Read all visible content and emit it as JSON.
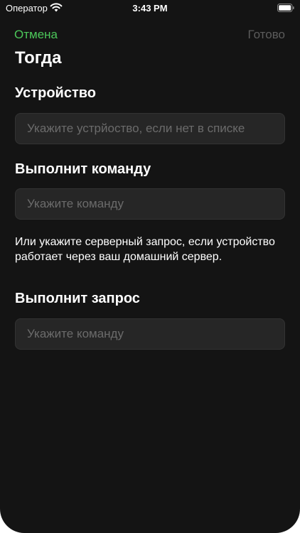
{
  "status_bar": {
    "carrier": "Оператор",
    "time": "3:43 PM",
    "wifi_icon": "wifi-icon",
    "battery_icon": "battery-icon"
  },
  "nav": {
    "cancel_label": "Отмена",
    "done_label": "Готово"
  },
  "page": {
    "title": "Тогда"
  },
  "device_section": {
    "title": "Устройство",
    "placeholder": "Укажите устрйоство, если нет в списке",
    "value": ""
  },
  "command_section": {
    "title": "Выполнит команду",
    "placeholder": "Укажите команду",
    "value": ""
  },
  "hint": {
    "text": "Или укажите серверный запрос, если устройство работает через ваш домашний сервер."
  },
  "request_section": {
    "title": "Выполнит запрос",
    "placeholder": "Укажите команду",
    "value": ""
  },
  "colors": {
    "background": "#141414",
    "accent": "#4cc85a",
    "disabled": "#5c5c5c",
    "field": "#262626"
  }
}
